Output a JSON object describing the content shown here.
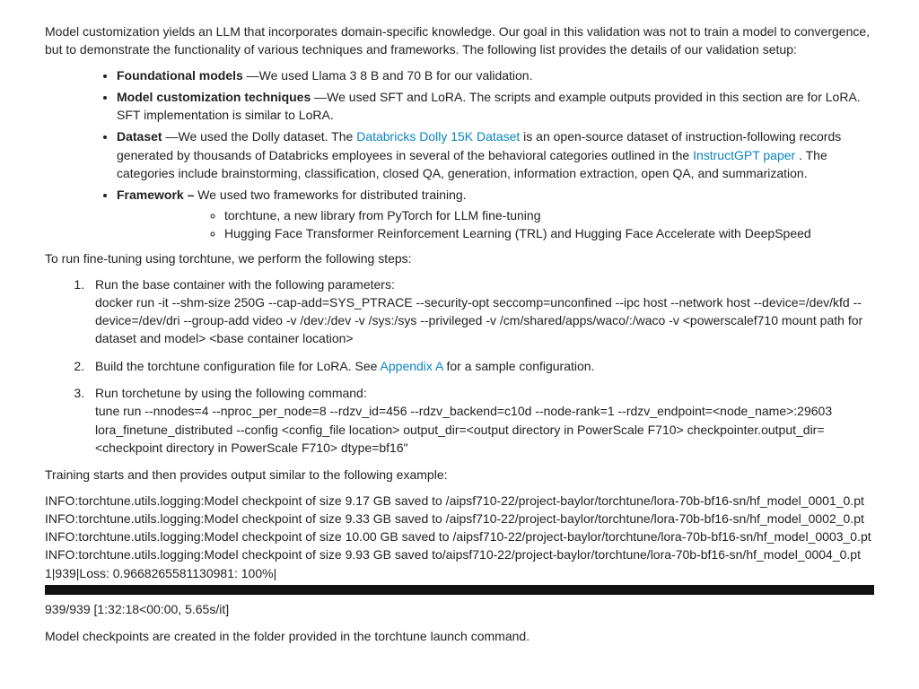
{
  "intro": "Model customization yields an LLM that incorporates domain-specific knowledge. Our goal in this validation was not to train a model to convergence, but to demonstrate the functionality of various techniques and frameworks. The following list provides the details of our validation setup:",
  "bullets": {
    "b1_label": "Foundational models",
    "b1_text": " —We used Llama 3 8 B and 70 B for our validation.",
    "b2_label": "Model customization techniques",
    "b2_text": " —We used SFT and LoRA. The scripts and example outputs provided in this section are for LoRA. SFT implementation is similar to LoRA.",
    "b3_label": "Dataset",
    "b3_pre": " —We used the Dolly dataset. The ",
    "b3_link": "Databricks Dolly 15K Dataset",
    "b3_mid": " is an open-source dataset of instruction-following records generated by thousands of Databricks employees in several of the behavioral categories outlined in the ",
    "b3_link2": "InstructGPT paper",
    "b3_post": " . The categories include brainstorming, classification, closed QA, generation, information extraction, open QA, and summarization.",
    "b4_label": "Framework –",
    "b4_text": " We used two frameworks for distributed training.",
    "b4_sub1": "torchtune, a new library from PyTorch for LLM fine-tuning",
    "b4_sub2": "Hugging Face Transformer Reinforcement Learning (TRL) and Hugging Face Accelerate with DeepSpeed"
  },
  "para2": "To run fine-tuning using torchtune, we perform the following steps:",
  "steps": {
    "s1a": "Run the base container with the following parameters:",
    "s1b": "docker run -it --shm-size 250G --cap-add=SYS_PTRACE --security-opt seccomp=unconfined --ipc host --network host --device=/dev/kfd --device=/dev/dri --group-add video -v /dev:/dev -v /sys:/sys --privileged -v /cm/shared/apps/waco/:/waco -v <powerscalef710 mount path for dataset and model> <base container location>",
    "s2a": "Build the torchtune configuration file for LoRA. See ",
    "s2link": "Appendix A",
    "s2b": " for a sample configuration.",
    "s3a": "Run torchetune by using the following command:",
    "s3b": "tune run --nnodes=4 --nproc_per_node=8 --rdzv_id=456 --rdzv_backend=c10d --node-rank=1 --rdzv_endpoint=<node_name>:29603 lora_finetune_distributed --config <config_file location> output_dir=<output directory in PowerScale F710> checkpointer.output_dir=<checkpoint directory in PowerScale F710> dtype=bf16\""
  },
  "para3": "Training starts and then provides output similar to the following example:",
  "log": {
    "l1": "INFO:torchtune.utils.logging:Model checkpoint of size 9.17 GB saved to /aipsf710-22/project-baylor/torchtune/lora-70b-bf16-sn/hf_model_0001_0.pt",
    "l2": "INFO:torchtune.utils.logging:Model checkpoint of size 9.33 GB saved to /aipsf710-22/project-baylor/torchtune/lora-70b-bf16-sn/hf_model_0002_0.pt",
    "l3": "INFO:torchtune.utils.logging:Model checkpoint of size 10.00 GB saved to /aipsf710-22/project-baylor/torchtune/lora-70b-bf16-sn/hf_model_0003_0.pt",
    "l4": "INFO:torchtune.utils.logging:Model checkpoint of size 9.93 GB saved to/aipsf710-22/project-baylor/torchtune/lora-70b-bf16-sn/hf_model_0004_0.pt",
    "l5": "1|939|Loss: 0.9668265581130981: 100%|",
    "l6": "939/939 [1:32:18<00:00, 5.65s/it]"
  },
  "para4": "Model checkpoints are created in the folder provided in the torchtune launch command."
}
